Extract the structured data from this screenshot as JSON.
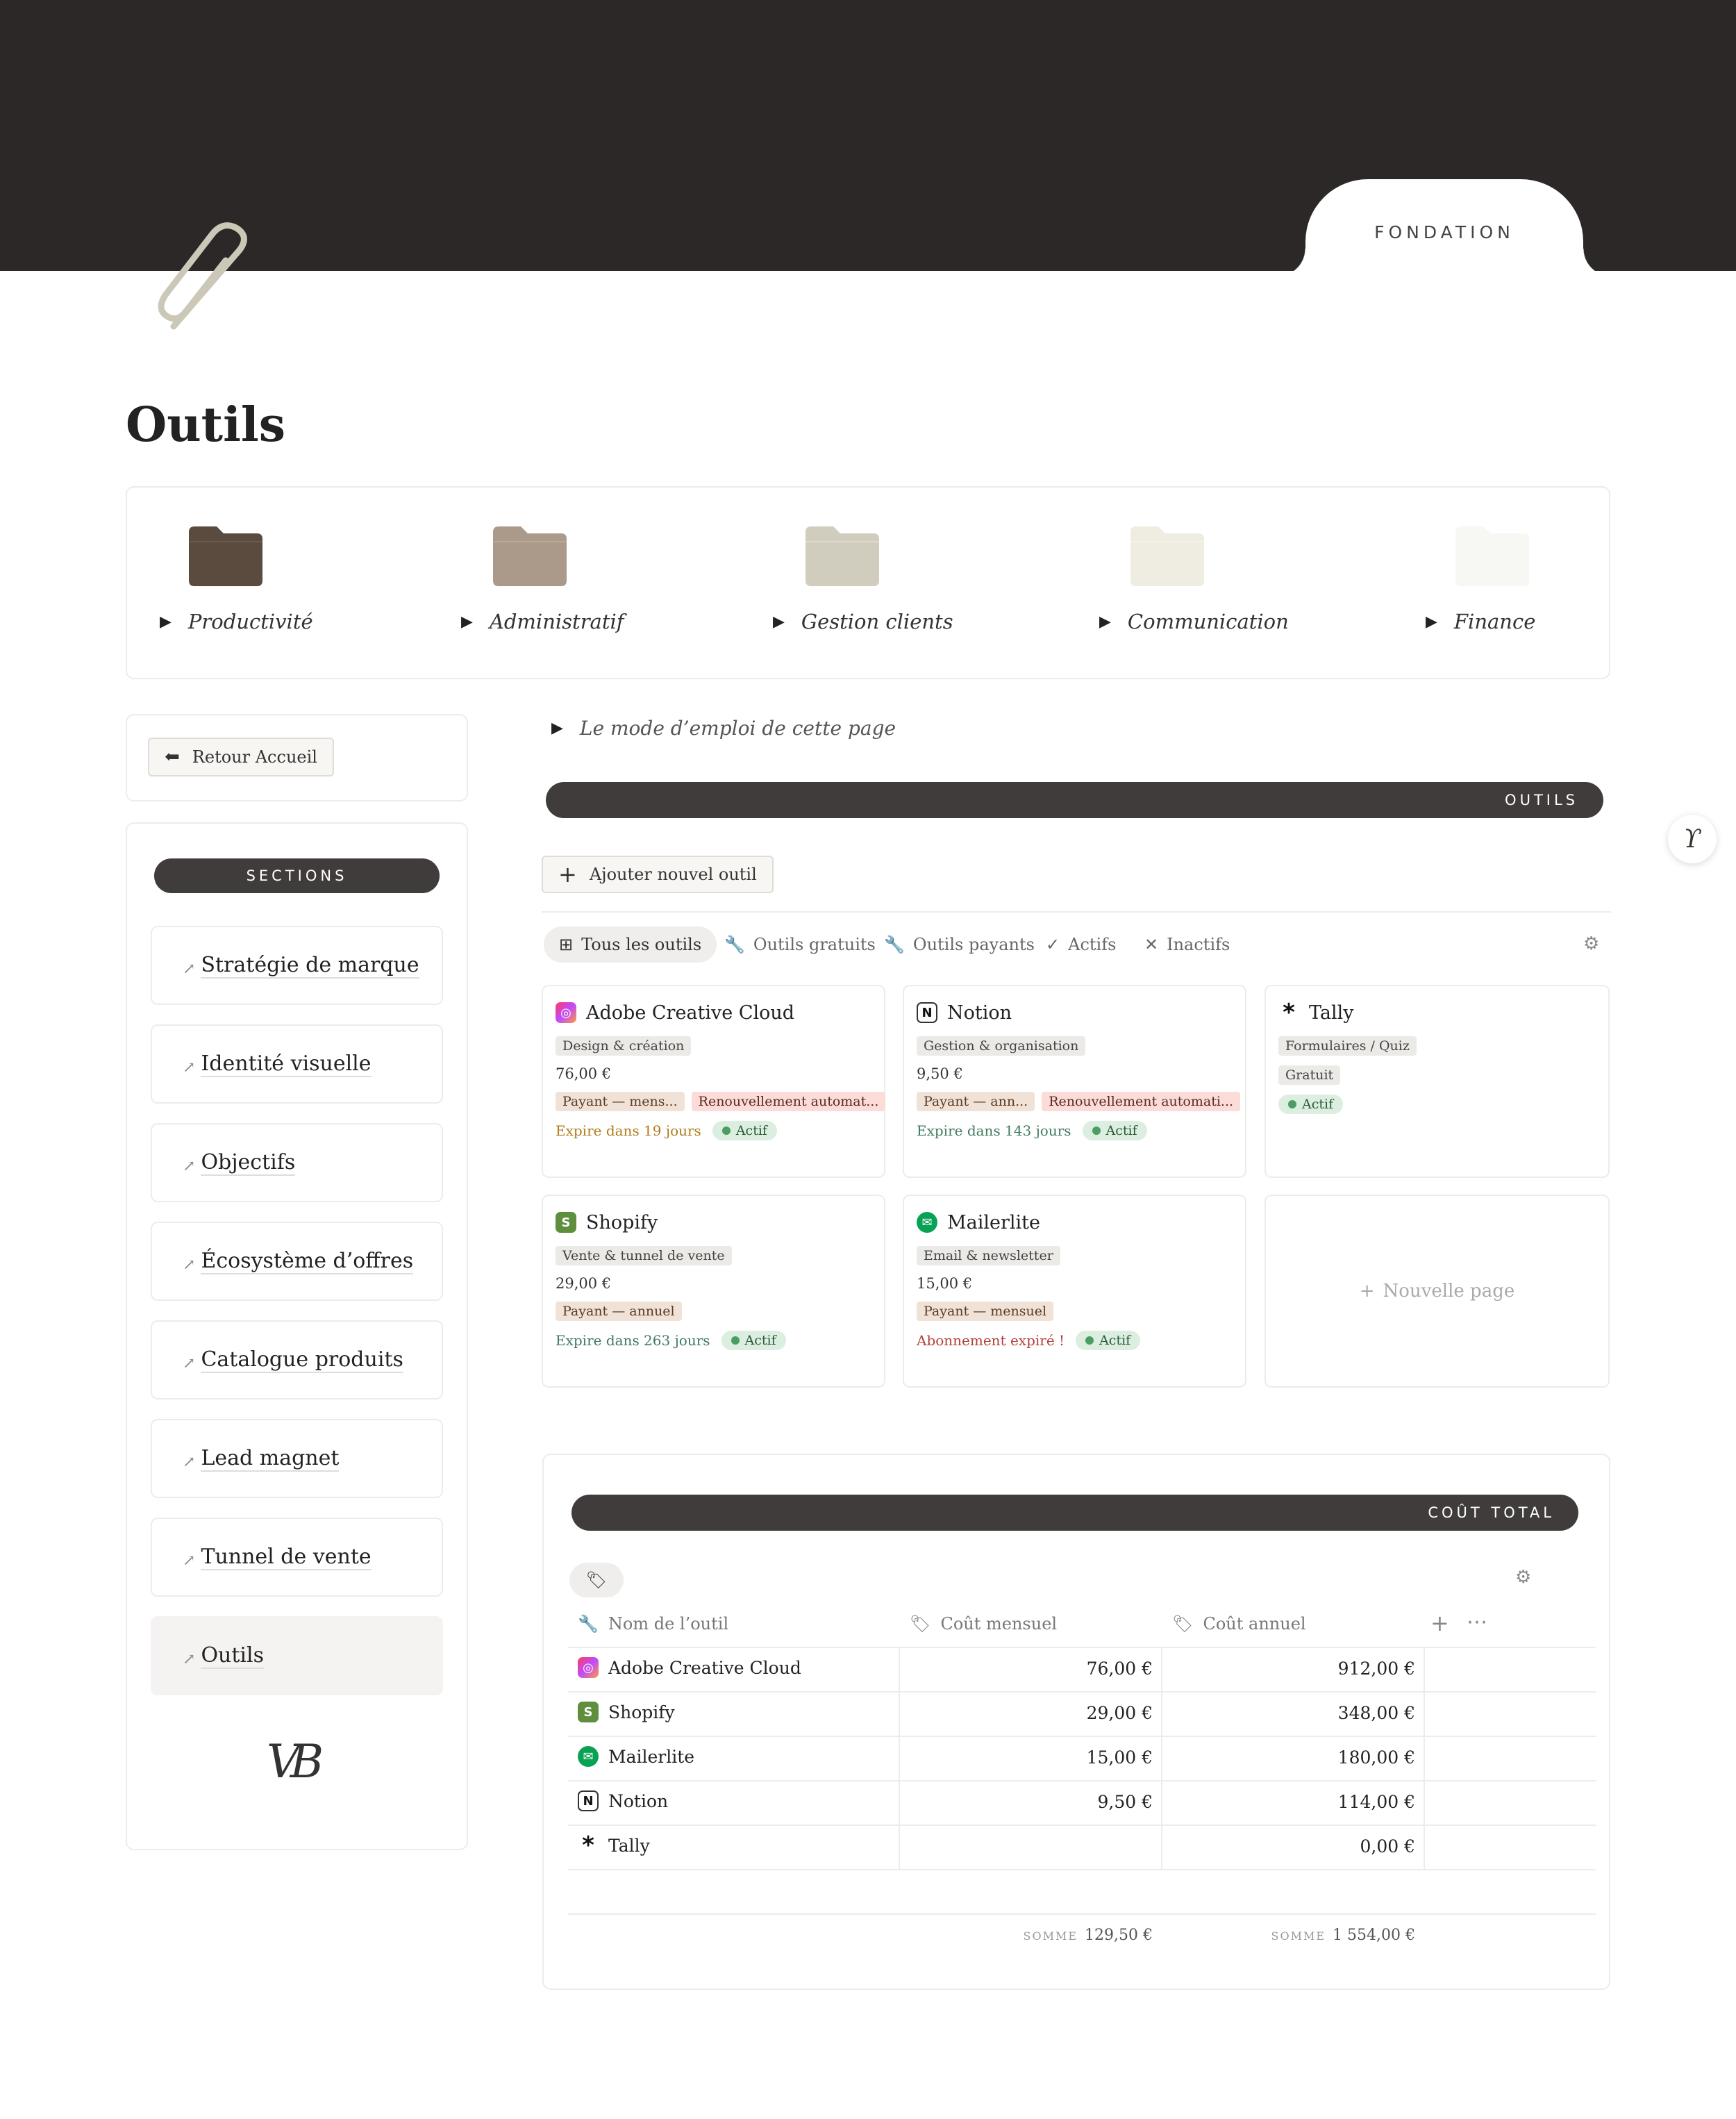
{
  "banner": {
    "tab_label": "FONDATION"
  },
  "page": {
    "title": "Outils"
  },
  "folders": [
    {
      "label": "Productivité",
      "color": "#5b4a3e"
    },
    {
      "label": "Administratif",
      "color": "#ab9a8a"
    },
    {
      "label": "Gestion clients",
      "color": "#d0cdbf"
    },
    {
      "label": "Communication",
      "color": "#efede2"
    },
    {
      "label": "Finance",
      "color": "#f7f7f3"
    }
  ],
  "sidebar": {
    "back_button": "Retour Accueil",
    "sections_label": "SECTIONS",
    "items": [
      {
        "label": "Stratégie de marque"
      },
      {
        "label": "Identité visuelle"
      },
      {
        "label": "Objectifs"
      },
      {
        "label": "Écosystème d’offres"
      },
      {
        "label": "Catalogue produits"
      },
      {
        "label": "Lead magnet"
      },
      {
        "label": "Tunnel de vente"
      },
      {
        "label": "Outils"
      }
    ],
    "logo_text": "VB"
  },
  "main": {
    "toggle_label": "Le mode d’emploi de cette page",
    "outils_header": "OUTILS",
    "add_button": "Ajouter nouvel outil",
    "tabs": [
      {
        "label": "Tous les outils",
        "icon": "grid-icon"
      },
      {
        "label": "Outils gratuits",
        "icon": "wrench-icon"
      },
      {
        "label": "Outils payants",
        "icon": "wrench-icon"
      },
      {
        "label": "Actifs",
        "icon": "check-icon"
      },
      {
        "label": "Inactifs",
        "icon": "x-icon"
      }
    ],
    "cards": [
      {
        "name": "Adobe Creative Cloud",
        "category": "Design & création",
        "price": "76,00 €",
        "billing": "Payant — mens...",
        "renewal": "Renouvellement automat...",
        "expiry": "Expire dans 19 jours",
        "status": "Actif"
      },
      {
        "name": "Notion",
        "category": "Gestion & organisation",
        "price": "9,50 €",
        "billing": "Payant — ann...",
        "renewal": "Renouvellement automati...",
        "expiry": "Expire dans 143 jours",
        "status": "Actif"
      },
      {
        "name": "Tally",
        "category": "Formulaires / Quiz",
        "free": "Gratuit",
        "status": "Actif"
      },
      {
        "name": "Shopify",
        "category": "Vente & tunnel de vente",
        "price": "29,00 €",
        "billing": "Payant — annuel",
        "expiry": "Expire dans 263 jours",
        "status": "Actif"
      },
      {
        "name": "Mailerlite",
        "category": "Email & newsletter",
        "price": "15,00 €",
        "billing": "Payant — mensuel",
        "expiry": "Abonnement expiré !",
        "status": "Actif"
      }
    ],
    "new_page": "Nouvelle page",
    "expiry_colors": {
      "warn": "#b07a1a",
      "ok": "#3f7a5e",
      "expired": "#b2403a"
    }
  },
  "cost": {
    "header": "COÛT TOTAL",
    "columns": [
      "Nom de l’outil",
      "Coût mensuel",
      "Coût annuel"
    ],
    "rows": [
      {
        "name": "Adobe Creative Cloud",
        "monthly": "76,00 €",
        "annual": "912,00 €"
      },
      {
        "name": "Shopify",
        "monthly": "29,00 €",
        "annual": "348,00 €"
      },
      {
        "name": "Mailerlite",
        "monthly": "15,00 €",
        "annual": "180,00 €"
      },
      {
        "name": "Notion",
        "monthly": "9,50 €",
        "annual": "114,00 €"
      },
      {
        "name": "Tally",
        "monthly": "",
        "annual": "0,00 €"
      }
    ],
    "sum_label": "SOMME",
    "sum_monthly": "129,50 €",
    "sum_annual": "1 554,00 €"
  }
}
